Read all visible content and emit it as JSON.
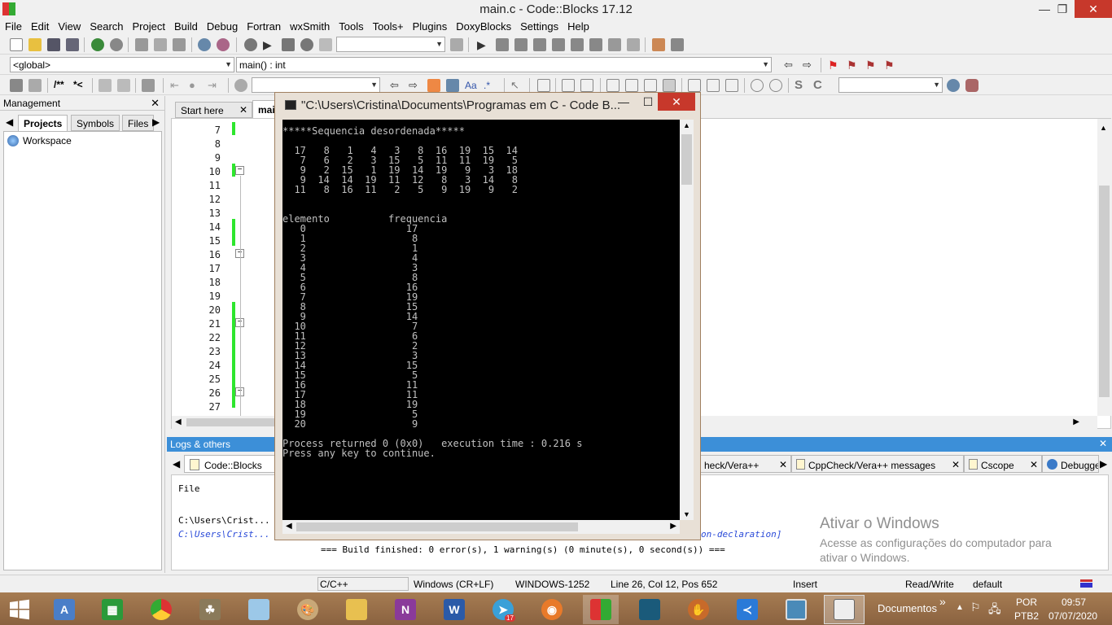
{
  "window": {
    "title": "main.c - Code::Blocks 17.12",
    "min": "—",
    "max": "❐",
    "close": "✕"
  },
  "menu": [
    "File",
    "Edit",
    "View",
    "Search",
    "Project",
    "Build",
    "Debug",
    "Fortran",
    "wxSmith",
    "Tools",
    "Tools+",
    "Plugins",
    "DoxyBlocks",
    "Settings",
    "Help"
  ],
  "toolbar2": {
    "scope": "<global>",
    "function": "main() : int",
    "doxy_comment": "/**",
    "doxy_line": "*<"
  },
  "management": {
    "title": "Management",
    "close": "✕",
    "tabs": [
      "Projects",
      "Symbols",
      "Files"
    ],
    "tree_root": "Workspace"
  },
  "editor": {
    "tabs": [
      "Start here",
      "main.c"
    ],
    "line_numbers": [
      "7",
      "8",
      "9",
      "10",
      "11",
      "12",
      "13",
      "14",
      "15",
      "16",
      "17",
      "18",
      "19",
      "20",
      "21",
      "22",
      "23",
      "24",
      "25",
      "26",
      "27"
    ]
  },
  "logs": {
    "title": "Logs & others",
    "close": "✕",
    "tabs": [
      "Code::Blocks",
      "heck/Vera++",
      "CppCheck/Vera++ messages",
      "Cscope",
      "Debugge"
    ],
    "column": "File",
    "line1": "C:\\Users\\Crist...",
    "line2": "C:\\Users\\Crist...",
    "line2_suffix": "on-declaration]",
    "build_line": "=== Build finished: 0 error(s), 1 warning(s) (0 minute(s), 0 second(s)) ==="
  },
  "status": {
    "language": "C/C++",
    "eol": "Windows (CR+LF)",
    "encoding": "WINDOWS-1252",
    "position": "Line 26, Col 12, Pos 652",
    "mode": "Insert",
    "access": "Read/Write",
    "profile": "default"
  },
  "console": {
    "title": "\"C:\\Users\\Cristina\\Documents\\Programas em C - Code B...",
    "min": "—",
    "max": "☐",
    "close": "✕",
    "output": "*****Sequencia desordenada*****\n\n  17   8   1   4   3   8  16  19  15  14\n   7   6   2   3  15   5  11  11  19   5\n   9   2  15   1  19  14  19   9   3  18\n   9  14  14  19  11  12   8   3  14   8\n  11   8  16  11   2   5   9  19   9   2\n\n\nelemento          frequencia\n   0                 17\n   1                  8\n   2                  1\n   3                  4\n   4                  3\n   5                  8\n   6                 16\n   7                 19\n   8                 15\n   9                 14\n  10                  7\n  11                  6\n  12                  2\n  13                  3\n  14                 15\n  15                  5\n  16                 11\n  17                 11\n  18                 19\n  19                  5\n  20                  9\n\nProcess returned 0 (0x0)   execution time : 0.216 s\nPress any key to continue."
  },
  "watermark": {
    "title": "Ativar o Windows",
    "line1": "Acesse as configurações do computador para",
    "line2": "ativar o Windows."
  },
  "taskbar": {
    "documents": "Documentos",
    "chevron": "»",
    "lang1": "POR",
    "lang2": "PTB2",
    "time": "09:57",
    "date": "07/07/2020",
    "telegram_badge": "17"
  }
}
